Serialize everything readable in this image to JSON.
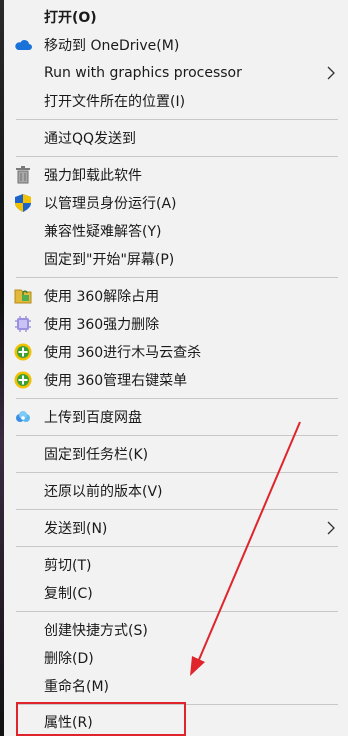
{
  "menu": {
    "items": [
      {
        "label": "打开(O)",
        "icon": "none",
        "bold": true
      },
      {
        "label": "移动到 OneDrive(M)",
        "icon": "onedrive-icon"
      },
      {
        "label": "Run with graphics processor",
        "icon": "none",
        "submenu": true
      },
      {
        "label": "打开文件所在的位置(I)",
        "icon": "none"
      },
      {
        "label": "通过QQ发送到",
        "icon": "none"
      },
      {
        "label": "强力卸载此软件",
        "icon": "trash-icon"
      },
      {
        "label": "以管理员身份运行(A)",
        "icon": "uac-shield-icon"
      },
      {
        "label": "兼容性疑难解答(Y)",
        "icon": "none"
      },
      {
        "label": "固定到\"开始\"屏幕(P)",
        "icon": "none"
      },
      {
        "label": "使用 360解除占用",
        "icon": "unlock-360-icon"
      },
      {
        "label": "使用 360强力删除",
        "icon": "delete-360-icon"
      },
      {
        "label": "使用 360进行木马云查杀",
        "icon": "scan-360-icon"
      },
      {
        "label": "使用 360管理右键菜单",
        "icon": "manage-360-icon"
      },
      {
        "label": "上传到百度网盘",
        "icon": "baidu-netdisk-icon"
      },
      {
        "label": "固定到任务栏(K)",
        "icon": "none"
      },
      {
        "label": "还原以前的版本(V)",
        "icon": "none"
      },
      {
        "label": "发送到(N)",
        "icon": "none",
        "submenu": true
      },
      {
        "label": "剪切(T)",
        "icon": "none"
      },
      {
        "label": "复制(C)",
        "icon": "none"
      },
      {
        "label": "创建快捷方式(S)",
        "icon": "none"
      },
      {
        "label": "删除(D)",
        "icon": "none"
      },
      {
        "label": "重命名(M)",
        "icon": "none"
      },
      {
        "label": "属性(R)",
        "icon": "none",
        "highlighted": true
      }
    ]
  },
  "colors": {
    "menu_bg": "#f2f2f2",
    "separator": "#c8c8c8",
    "annotation_red": "#e0242c"
  }
}
